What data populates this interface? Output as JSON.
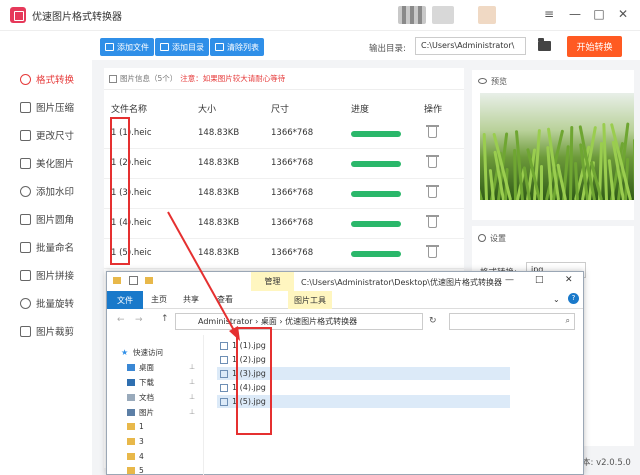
{
  "app": {
    "title": "优速图片格式转换器",
    "version": "本: v2.0.5.0"
  },
  "toolbar": {
    "add_file": "添加文件",
    "add_dir": "添加目录",
    "clear_list": "清除列表",
    "output_label": "输出目录:",
    "output_path": "C:\\Users\\Administrator\\",
    "start": "开始转换"
  },
  "sidebar": {
    "items": [
      {
        "label": "格式转换",
        "active": true
      },
      {
        "label": "图片压缩"
      },
      {
        "label": "更改尺寸"
      },
      {
        "label": "美化图片"
      },
      {
        "label": "添加水印"
      },
      {
        "label": "图片圆角"
      },
      {
        "label": "批量命名"
      },
      {
        "label": "图片拼接"
      },
      {
        "label": "批量旋转"
      },
      {
        "label": "图片裁剪"
      }
    ]
  },
  "panel": {
    "info": "图片信息（5个）",
    "warning": "注意：如果图片较大请耐心等待",
    "columns": [
      "文件名称",
      "大小",
      "尺寸",
      "进度",
      "操作"
    ],
    "rows": [
      {
        "name": "1 (1).heic",
        "size": "148.83KB",
        "dim": "1366*768",
        "progress": 1.0
      },
      {
        "name": "1 (2).heic",
        "size": "148.83KB",
        "dim": "1366*768",
        "progress": 1.0
      },
      {
        "name": "1 (3).heic",
        "size": "148.83KB",
        "dim": "1366*768",
        "progress": 1.0
      },
      {
        "name": "1 (4).heic",
        "size": "148.83KB",
        "dim": "1366*768",
        "progress": 1.0
      },
      {
        "name": "1 (5).heic",
        "size": "148.83KB",
        "dim": "1366*768",
        "progress": 1.0
      }
    ]
  },
  "preview": {
    "label": "预览"
  },
  "settings": {
    "label": "设置",
    "format_label": "格式转换:",
    "format_value": "jpg"
  },
  "explorer": {
    "manage": "管理",
    "title_path": "C:\\Users\\Administrator\\Desktop\\优速图片格式转换器",
    "tabs": [
      "文件",
      "主页",
      "共享",
      "查看"
    ],
    "tools_tab": "图片工具",
    "address": [
      "Administrator",
      "桌面",
      "优速图片格式转换器"
    ],
    "tree": [
      "快速访问",
      "桌面",
      "下载",
      "文档",
      "图片",
      "1",
      "3",
      "4",
      "5"
    ],
    "files": [
      "1 (1).jpg",
      "1 (2).jpg",
      "1 (3).jpg",
      "1 (4).jpg",
      "1 (5).jpg"
    ]
  },
  "colors": {
    "accent": "#2f8fe8",
    "start": "#ff5a22",
    "progress": "#2ab76a",
    "highlight": "#e53030"
  }
}
